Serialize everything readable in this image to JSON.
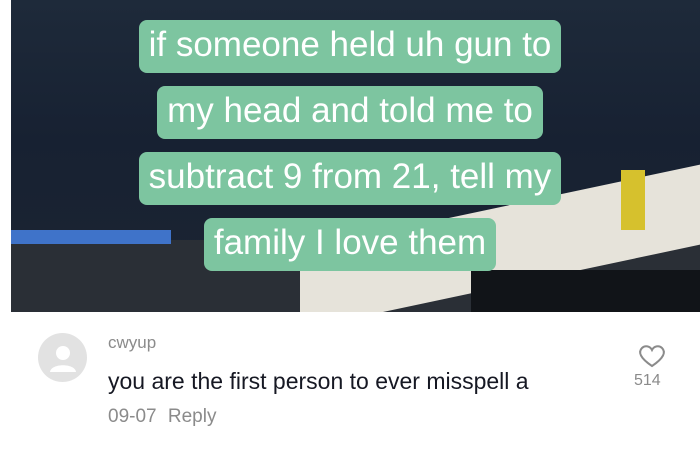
{
  "video": {
    "caption_lines": [
      "if someone held uh gun to",
      "my head and told me to",
      "subtract 9 from 21, tell my",
      "family I love them"
    ]
  },
  "comment": {
    "username": "cwyup",
    "text": "you are the first person to ever misspell a",
    "date": "09-07",
    "reply_label": "Reply",
    "like_count": "514"
  },
  "icons": {
    "avatar": "user-avatar-icon",
    "like": "heart-icon"
  },
  "colors": {
    "caption_bg": "#7dc5a0",
    "meta_text": "#8b8b8b",
    "comment_text": "#161823"
  }
}
